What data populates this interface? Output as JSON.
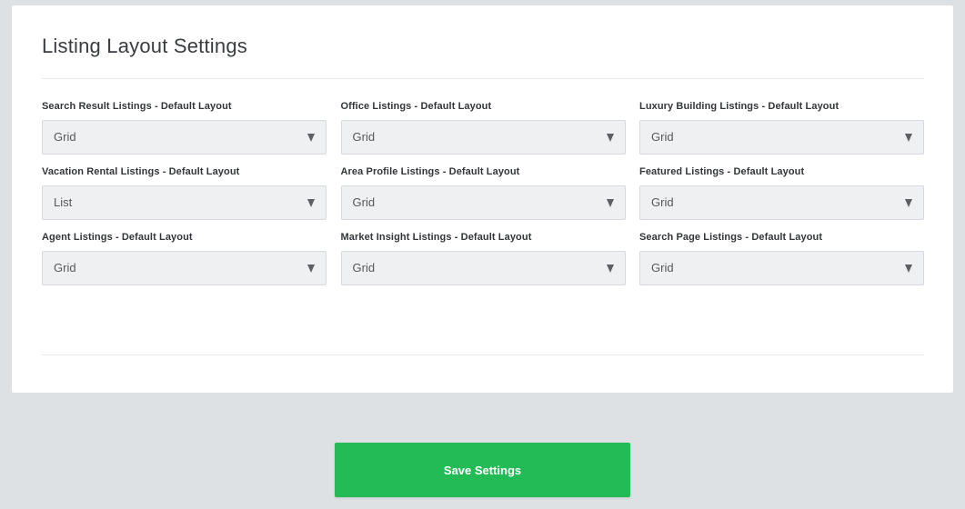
{
  "panel": {
    "title": "Listing Layout Settings"
  },
  "fields": [
    {
      "label": "Search Result Listings - Default Layout",
      "value": "Grid"
    },
    {
      "label": "Office Listings - Default Layout",
      "value": "Grid"
    },
    {
      "label": "Luxury Building Listings - Default Layout",
      "value": "Grid"
    },
    {
      "label": "Vacation Rental Listings - Default Layout",
      "value": "List"
    },
    {
      "label": "Area Profile Listings - Default Layout",
      "value": "Grid"
    },
    {
      "label": "Featured Listings - Default Layout",
      "value": "Grid"
    },
    {
      "label": "Agent Listings - Default Layout",
      "value": "Grid"
    },
    {
      "label": "Market Insight Listings - Default Layout",
      "value": "Grid"
    },
    {
      "label": "Search Page Listings - Default Layout",
      "value": "Grid"
    }
  ],
  "actions": {
    "save_label": "Save Settings"
  },
  "icons": {
    "select_caret": "caret-down-icon"
  },
  "colors": {
    "background": "#dde1e4",
    "panel": "#ffffff",
    "select_bg": "#eff0f2",
    "accent_green": "#22bb55"
  }
}
